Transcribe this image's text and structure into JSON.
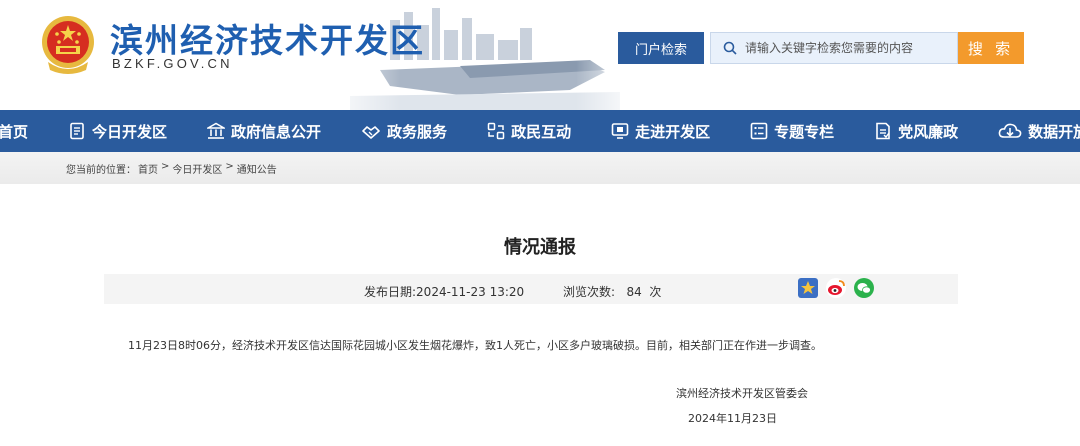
{
  "header": {
    "site_title": "滨州经济技术开发区",
    "site_domain": "BZKF.GOV.CN",
    "search_scope": "门户检索",
    "search_placeholder": "请输入关键字检索您需要的内容",
    "search_button": "搜 索"
  },
  "nav": {
    "items": [
      {
        "label": "首页",
        "icon": "home"
      },
      {
        "label": "今日开发区",
        "icon": "document-icon"
      },
      {
        "label": "政府信息公开",
        "icon": "building-icon"
      },
      {
        "label": "政务服务",
        "icon": "handshake-icon"
      },
      {
        "label": "政民互动",
        "icon": "interaction-icon"
      },
      {
        "label": "走进开发区",
        "icon": "monitor-icon"
      },
      {
        "label": "专题专栏",
        "icon": "list-icon"
      },
      {
        "label": "党风廉政",
        "icon": "report-icon"
      },
      {
        "label": "数据开放",
        "icon": "cloud-download-icon"
      }
    ]
  },
  "breadcrumb": {
    "prefix": "您当前的位置：",
    "items": [
      "首页",
      "今日开发区",
      "通知公告"
    ],
    "separator": ">"
  },
  "article": {
    "title": "情况通报",
    "publish_date": "发布日期:2024-11-23 13:20",
    "views": "浏览次数:   84  次",
    "body": "11月23日8时06分，经济技术开发区信达国际花园城小区发生烟花爆炸，致1人死亡，小区多户玻璃破损。目前，相关部门正在作进一步调查。",
    "sign_org": "滨州经济技术开发区管委会",
    "sign_date": "2024年11月23日"
  },
  "colors": {
    "nav_bg": "#2a5b9d",
    "title_blue": "#1f5fb0",
    "search_button": "#f39a2c"
  }
}
